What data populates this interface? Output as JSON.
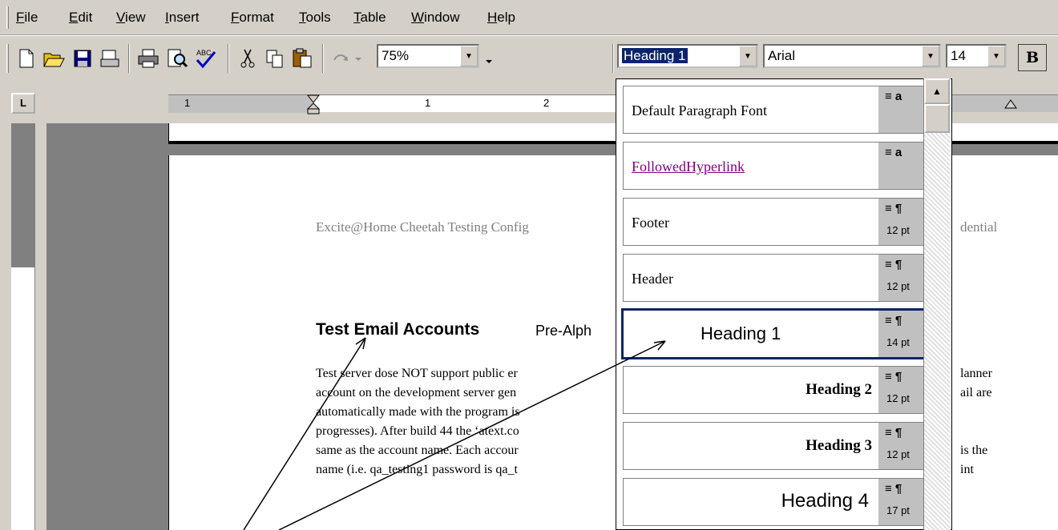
{
  "menu": [
    "File",
    "Edit",
    "View",
    "Insert",
    "Format",
    "Tools",
    "Table",
    "Window",
    "Help"
  ],
  "toolbar": {
    "zoom": "75%",
    "style": "Heading 1",
    "font": "Arial",
    "size": "14",
    "bold_label": "B"
  },
  "ruler": {
    "marks": [
      "1",
      "1",
      "2"
    ]
  },
  "document": {
    "header_left": "Excite@Home Cheetah Testing Config",
    "header_right": "dential",
    "heading_bold": "Test Email Accounts",
    "heading_rest": "Pre-Alph",
    "body_lines": [
      "Test server dose NOT support public er",
      "account on the development server gen",
      "automatically made with the program is",
      "progresses). After build 44 the ‘atext.co",
      "same as the account name. Each accour",
      "name (i.e. qa_testing1 password is qa_t"
    ],
    "right_lines": [
      "lanner",
      "ail are",
      "is the",
      "int"
    ]
  },
  "style_dropdown": {
    "items": [
      {
        "name": "Default Paragraph Font",
        "sym": "≡ a",
        "pt": ""
      },
      {
        "name": "FollowedHyperlink",
        "sym": "≡ a",
        "pt": ""
      },
      {
        "name": "Footer",
        "sym": "≡ ¶",
        "pt": "12 pt"
      },
      {
        "name": "Header",
        "sym": "≡ ¶",
        "pt": "12 pt"
      },
      {
        "name": "Heading 1",
        "sym": "≡ ¶",
        "pt": "14 pt"
      },
      {
        "name": "Heading 2",
        "sym": "≡ ¶",
        "pt": "12 pt"
      },
      {
        "name": "Heading 3",
        "sym": "≡ ¶",
        "pt": "12 pt"
      },
      {
        "name": "Heading 4",
        "sym": "≡ ¶",
        "pt": "17 pt"
      }
    ]
  },
  "colors": {
    "selection": "#0a246a",
    "hyperlink": "#800080"
  }
}
